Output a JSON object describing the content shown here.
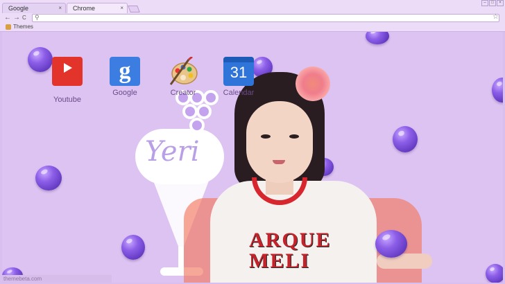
{
  "tabs": [
    {
      "label": "Google",
      "close": "×"
    },
    {
      "label": "Chrome",
      "close": "×"
    }
  ],
  "toolbar": {
    "back": "←",
    "forward": "→",
    "reload": "C",
    "search_icon": "search-icon",
    "star_icon": "star-icon"
  },
  "bookmarks": [
    {
      "label": "Themes"
    }
  ],
  "shortcuts": [
    {
      "label": "Youtube",
      "icon": "youtube-icon"
    },
    {
      "label": "Google",
      "icon": "google-icon",
      "glyph": "g"
    },
    {
      "label": "Creator",
      "icon": "palette-icon"
    },
    {
      "label": "Calendar",
      "icon": "calendar-icon",
      "glyph": "31"
    }
  ],
  "background": {
    "cream_text": "Yeri",
    "shirt_text_line1": "ARQUE",
    "shirt_text_line2": "MELI"
  },
  "watermark": "themebeta.com",
  "colors": {
    "page_bg": "#dcc3f2",
    "chrome_bg": "#ecdcf7",
    "grape": "#7a4bd6"
  }
}
